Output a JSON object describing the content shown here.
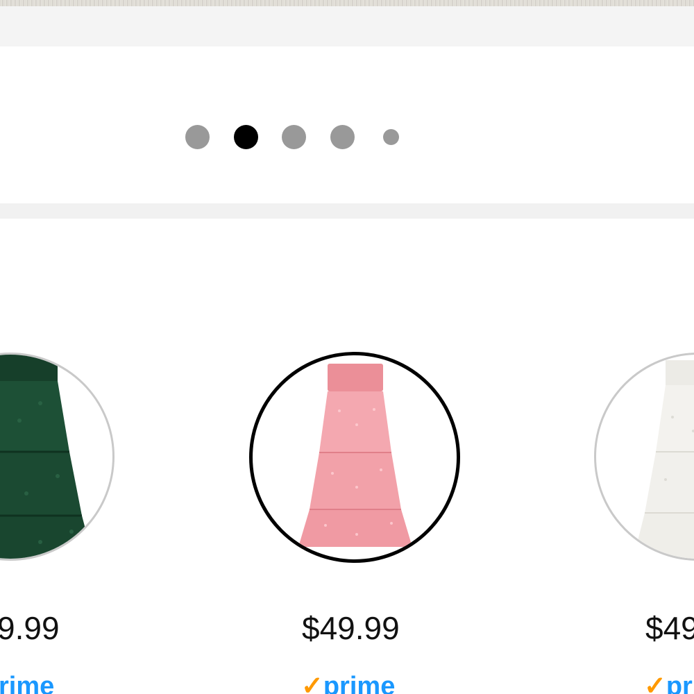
{
  "carousel": {
    "dots": [
      {
        "state": "inactive"
      },
      {
        "state": "active"
      },
      {
        "state": "inactive"
      },
      {
        "state": "inactive"
      },
      {
        "state": "inactive-small"
      }
    ],
    "active_index": 1
  },
  "swatches": [
    {
      "color_name": "green",
      "color": "#1d5036",
      "price": "9.99",
      "badge_check": "",
      "badge_word": "rime",
      "selected": false
    },
    {
      "color_name": "pink",
      "color": "#f2a1a9",
      "price": "$49.99",
      "badge_check": "✓",
      "badge_word": "prime",
      "selected": true
    },
    {
      "color_name": "white",
      "color": "#f1f0ec",
      "price": "$49",
      "badge_check": "✓",
      "badge_word": "pr",
      "selected": false
    }
  ],
  "colors": {
    "dot_inactive": "#999999",
    "dot_active": "#000000",
    "prime_blue": "#1a98ff",
    "prime_orange": "#ff9900"
  }
}
